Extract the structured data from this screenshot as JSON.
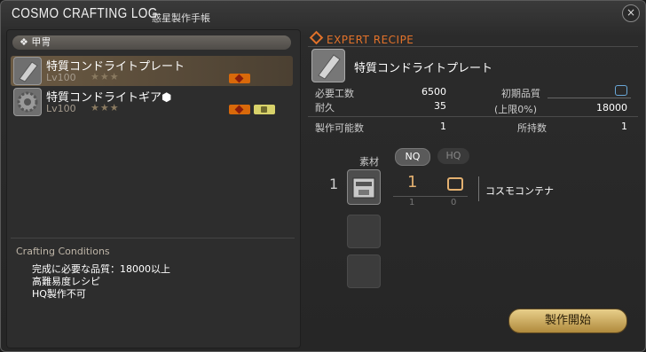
{
  "window": {
    "title": "COSMO CRAFTING LOG",
    "subtitle": "惑星製作手帳",
    "close_label": "×"
  },
  "left": {
    "category": "甲冑",
    "category_icon": "❖",
    "items": [
      {
        "name": "特質コンドライトプレート",
        "level": "Lv100",
        "stars": "★★★",
        "badges": [
          "expert-orange"
        ]
      },
      {
        "name": "特質コンドライトギア⬢",
        "level": "Lv100",
        "stars": "★★★",
        "badges": [
          "expert-orange",
          "yellow"
        ]
      }
    ],
    "conditions": {
      "title": "Crafting Conditions",
      "lines": [
        "完成に必要な品質：18000以上",
        "高難易度レシピ",
        "HQ製作不可"
      ]
    }
  },
  "right": {
    "expert_label": "EXPERT RECIPE",
    "recipe_name": "特質コンドライトプレート",
    "stats": {
      "required_work_label": "必要工数",
      "required_work": "6500",
      "durability_label": "耐久",
      "durability": "35",
      "initial_quality_label": "初期品質",
      "quality_cap_label": "(上限0%)",
      "quality_cap": "18000",
      "craftable_label": "製作可能数",
      "craftable": "1",
      "owned_label": "所持数",
      "owned": "1"
    },
    "materials": {
      "header": "素材",
      "nq_label": "NQ",
      "hq_label": "HQ",
      "rows": [
        {
          "qty": "1",
          "nq": "1",
          "nq_have": "1",
          "hq_have": "0",
          "name": "コスモコンテナ"
        }
      ]
    },
    "craft_button": "製作開始"
  },
  "colors": {
    "accent": "#e2722a",
    "button": "#d9bf72",
    "hq_box": "#6aa8d8"
  }
}
